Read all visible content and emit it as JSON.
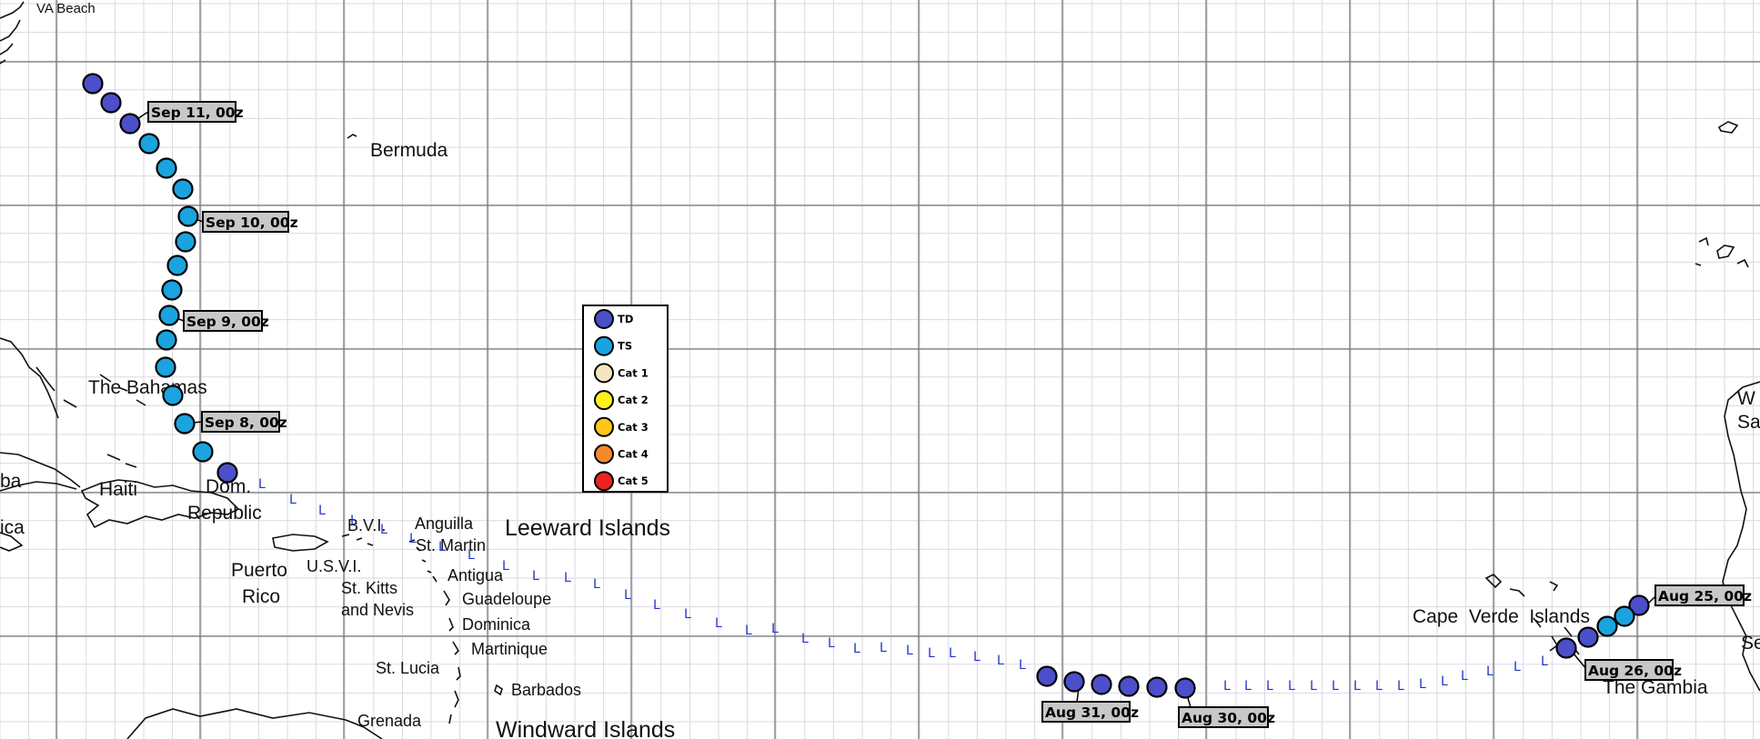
{
  "colors": {
    "TD": "#4b4fc9",
    "TS": "#1aa3de",
    "Cat 1": "#f3e6c0",
    "Cat 2": "#fff21a",
    "Cat 3": "#ffc61a",
    "Cat 4": "#f28a2a",
    "Cat 5": "#e8261f",
    "low_marker": "#2233cc",
    "label_fill": "#c8c8c8",
    "grid_major": "#7a7a7a",
    "grid_minor": "#d9d9e3"
  },
  "legend": {
    "items": [
      {
        "key": "TD",
        "label": "TD"
      },
      {
        "key": "TS",
        "label": "TS"
      },
      {
        "key": "Cat 1",
        "label": "Cat 1"
      },
      {
        "key": "Cat 2",
        "label": "Cat 2"
      },
      {
        "key": "Cat 3",
        "label": "Cat 3"
      },
      {
        "key": "Cat 4",
        "label": "Cat 4"
      },
      {
        "key": "Cat 5",
        "label": "Cat 5"
      }
    ]
  },
  "low_symbol": "L",
  "places": [
    {
      "text": "VA Beach"
    },
    {
      "text": "Bermuda"
    },
    {
      "text": "The Bahamas"
    },
    {
      "text": "Haiti"
    },
    {
      "text": "Dom."
    },
    {
      "text": "Republic"
    },
    {
      "text": "ba"
    },
    {
      "text": "ica"
    },
    {
      "text": "Puerto"
    },
    {
      "text": "Rico"
    },
    {
      "text": "B.V.I."
    },
    {
      "text": "U.S.V.I."
    },
    {
      "text": "Anguilla"
    },
    {
      "text": "St. Martin"
    },
    {
      "text": "Antigua"
    },
    {
      "text": "St. Kitts"
    },
    {
      "text": "and Nevis"
    },
    {
      "text": "Guadeloupe"
    },
    {
      "text": "Dominica"
    },
    {
      "text": "Martinique"
    },
    {
      "text": "St. Lucia"
    },
    {
      "text": "Barbados"
    },
    {
      "text": "Grenada"
    },
    {
      "text": "Leeward Islands"
    },
    {
      "text": "Windward Islands"
    },
    {
      "text": "Cape  Verde  Islands"
    },
    {
      "text": "The Gambia"
    },
    {
      "text": "W"
    },
    {
      "text": "Sa"
    },
    {
      "text": "Se"
    }
  ],
  "date_labels": [
    {
      "text": "Sep 11, 00z"
    },
    {
      "text": "Sep 10, 00z"
    },
    {
      "text": "Sep 9, 00z"
    },
    {
      "text": "Sep 8, 00z"
    },
    {
      "text": "Aug 31, 00z"
    },
    {
      "text": "Aug 30, 00z"
    },
    {
      "text": "Aug 26, 00z"
    },
    {
      "text": "Aug 25, 00z"
    }
  ],
  "track": [
    {
      "status": "TD"
    },
    {
      "status": "TS"
    },
    {
      "status": "TS"
    },
    {
      "status": "TD"
    },
    {
      "status": "TD"
    },
    {
      "status": "TD"
    },
    {
      "status": "TD"
    },
    {
      "status": "TD"
    },
    {
      "status": "TD"
    },
    {
      "status": "TS"
    },
    {
      "status": "TS"
    },
    {
      "status": "TS"
    },
    {
      "status": "TS"
    },
    {
      "status": "TS"
    },
    {
      "status": "TS"
    },
    {
      "status": "TS"
    },
    {
      "status": "TS"
    },
    {
      "status": "TS"
    },
    {
      "status": "TS"
    },
    {
      "status": "TS"
    },
    {
      "status": "TS"
    },
    {
      "status": "TS"
    },
    {
      "status": "TD"
    },
    {
      "status": "TD"
    },
    {
      "status": "TD"
    }
  ]
}
